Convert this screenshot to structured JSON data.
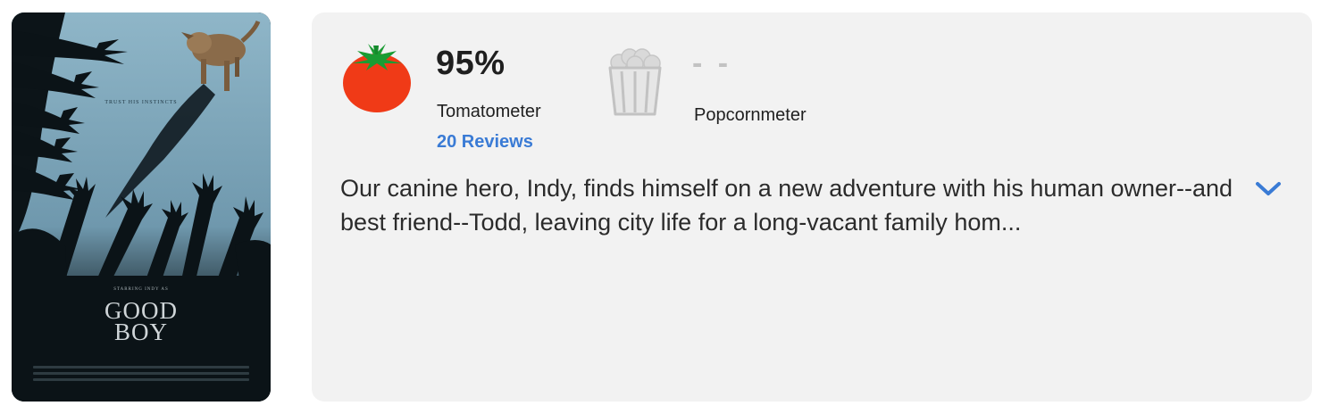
{
  "poster": {
    "alt": "Good Boy poster",
    "tagline": "TRUST HIS INSTINCTS",
    "starring": "STARRING INDY AS",
    "title_line1": "GOOD",
    "title_line2": "BOY"
  },
  "tomatometer": {
    "icon": "tomato-icon",
    "score": "95%",
    "label": "Tomatometer",
    "reviews": "20 Reviews"
  },
  "popcornmeter": {
    "icon": "popcorn-bucket-icon",
    "score": "- -",
    "label": "Popcornmeter"
  },
  "synopsis": "Our canine hero, Indy, finds himself on a new adventure with his human owner--and best friend--Todd, leaving city life for a long-vacant family hom...",
  "expand_icon": "chevron-down-icon",
  "colors": {
    "card_background": "#f2f2f2",
    "link": "#3a7bd5",
    "tomato_red": "#f03a17",
    "tomato_leaf": "#1a9c33",
    "popcorn_gray": "#c2c2c2",
    "poster_sky": "#86adc0"
  }
}
